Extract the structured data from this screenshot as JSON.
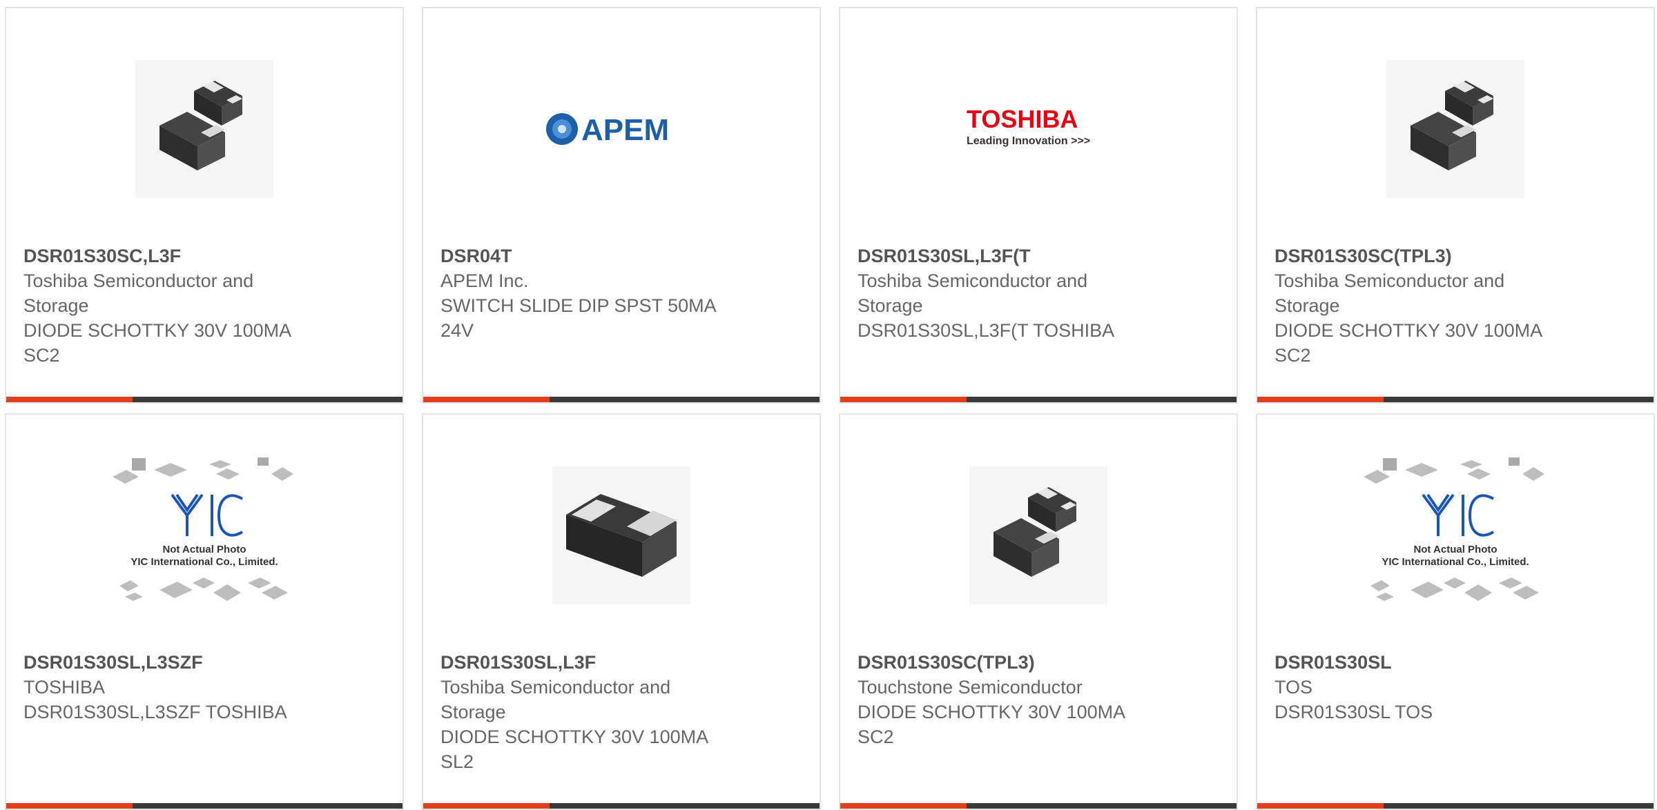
{
  "cards": [
    {
      "part_number": "DSR01S30SC,L3F",
      "manufacturer_lines": [
        "Toshiba Semiconductor and",
        "Storage"
      ],
      "description_lines": [
        "DIODE SCHOTTKY 30V 100MA",
        "SC2"
      ],
      "image": "diode-two-parts"
    },
    {
      "part_number": "DSR04T",
      "manufacturer_lines": [
        "APEM Inc."
      ],
      "description_lines": [
        "SWITCH SLIDE DIP SPST 50MA",
        "24V"
      ],
      "image": "apem-logo",
      "logo_text": "APEM"
    },
    {
      "part_number": "DSR01S30SL,L3F(T",
      "manufacturer_lines": [
        "Toshiba Semiconductor and",
        "Storage"
      ],
      "description_lines": [
        "DSR01S30SL,L3F(T TOSHIBA"
      ],
      "image": "toshiba-logo",
      "logo_text": "TOSHIBA",
      "logo_tagline": "Leading Innovation >>>"
    },
    {
      "part_number": "DSR01S30SC(TPL3)",
      "manufacturer_lines": [
        "Toshiba Semiconductor and",
        "Storage"
      ],
      "description_lines": [
        "DIODE SCHOTTKY 30V 100MA",
        "SC2"
      ],
      "image": "diode-two-parts"
    },
    {
      "part_number": "DSR01S30SL,L3SZF",
      "manufacturer_lines": [
        "TOSHIBA"
      ],
      "description_lines": [
        "DSR01S30SL,L3SZF TOSHIBA"
      ],
      "image": "yic-placeholder",
      "placeholder_line1": "Not Actual Photo",
      "placeholder_line2": "YIC International Co., Limited."
    },
    {
      "part_number": "DSR01S30SL,L3F",
      "manufacturer_lines": [
        "Toshiba Semiconductor and",
        "Storage"
      ],
      "description_lines": [
        "DIODE SCHOTTKY 30V 100MA",
        "SL2"
      ],
      "image": "diode-single"
    },
    {
      "part_number": "DSR01S30SC(TPL3)",
      "manufacturer_lines": [
        "Touchstone Semiconductor"
      ],
      "description_lines": [
        "DIODE SCHOTTKY 30V 100MA",
        "SC2"
      ],
      "image": "diode-two-parts"
    },
    {
      "part_number": "DSR01S30SL",
      "manufacturer_lines": [
        "TOS"
      ],
      "description_lines": [
        "DSR01S30SL TOS"
      ],
      "image": "yic-placeholder",
      "placeholder_line1": "Not Actual Photo",
      "placeholder_line2": "YIC International Co., Limited."
    }
  ],
  "colors": {
    "accent": "#e2401c",
    "bar": "#3a3a3a",
    "card_border": "#e3e3e3",
    "text": "#666666",
    "part_number": "#555555",
    "apem_blue": "#1d5fa8",
    "toshiba_red": "#e60012",
    "yic_blue": "#1a56b5"
  }
}
